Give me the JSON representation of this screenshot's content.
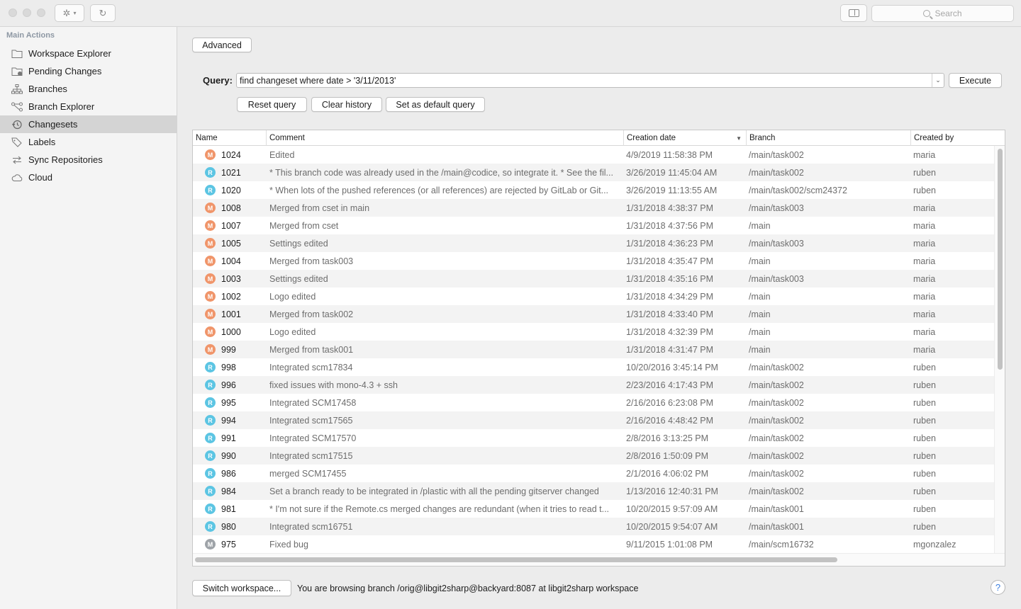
{
  "toolbar": {
    "gear_icon": "gear-icon",
    "refresh_icon": "refresh-icon",
    "panel_icon": "sidebar-toggle-icon",
    "search_placeholder": "Search"
  },
  "sidebar": {
    "header": "Main Actions",
    "items": [
      {
        "label": "Workspace Explorer",
        "icon": "folder-icon"
      },
      {
        "label": "Pending Changes",
        "icon": "pending-folder-icon"
      },
      {
        "label": "Branches",
        "icon": "branches-icon"
      },
      {
        "label": "Branch Explorer",
        "icon": "branch-explorer-icon"
      },
      {
        "label": "Changesets",
        "icon": "history-icon",
        "selected": true
      },
      {
        "label": "Labels",
        "icon": "tag-icon"
      },
      {
        "label": "Sync Repositories",
        "icon": "sync-icon"
      },
      {
        "label": "Cloud",
        "icon": "cloud-icon"
      }
    ]
  },
  "main": {
    "advanced_label": "Advanced",
    "query_label": "Query:",
    "query_value": "find changeset where date > '3/11/2013'",
    "execute_label": "Execute",
    "reset_label": "Reset query",
    "clear_label": "Clear history",
    "default_label": "Set as default query"
  },
  "table": {
    "columns": [
      "Name",
      "Comment",
      "Creation date",
      "Branch",
      "Created by"
    ],
    "sorted_column": "Creation date",
    "rows": [
      {
        "avatar": "M",
        "name": "1024",
        "comment": "Edited",
        "date": "4/9/2019 11:58:38 PM",
        "branch": "/main/task002",
        "by": "maria"
      },
      {
        "avatar": "R",
        "name": "1021",
        "comment": "* This branch code was already used in the /main@codice, so integrate it. * See the fil...",
        "date": "3/26/2019 11:45:04 AM",
        "branch": "/main/task002",
        "by": "ruben"
      },
      {
        "avatar": "R",
        "name": "1020",
        "comment": "* When lots of the pushed references (or all references)  are rejected by GitLab or Git...",
        "date": "3/26/2019 11:13:55 AM",
        "branch": "/main/task002/scm24372",
        "by": "ruben"
      },
      {
        "avatar": "M",
        "name": "1008",
        "comment": "Merged from cset in main",
        "date": "1/31/2018 4:38:37 PM",
        "branch": "/main/task003",
        "by": "maria"
      },
      {
        "avatar": "M",
        "name": "1007",
        "comment": "Merged from cset",
        "date": "1/31/2018 4:37:56 PM",
        "branch": "/main",
        "by": "maria"
      },
      {
        "avatar": "M",
        "name": "1005",
        "comment": "Settings edited",
        "date": "1/31/2018 4:36:23 PM",
        "branch": "/main/task003",
        "by": "maria"
      },
      {
        "avatar": "M",
        "name": "1004",
        "comment": "Merged from task003",
        "date": "1/31/2018 4:35:47 PM",
        "branch": "/main",
        "by": "maria"
      },
      {
        "avatar": "M",
        "name": "1003",
        "comment": "Settings edited",
        "date": "1/31/2018 4:35:16 PM",
        "branch": "/main/task003",
        "by": "maria"
      },
      {
        "avatar": "M",
        "name": "1002",
        "comment": "Logo edited",
        "date": "1/31/2018 4:34:29 PM",
        "branch": "/main",
        "by": "maria"
      },
      {
        "avatar": "M",
        "name": "1001",
        "comment": "Merged from task002",
        "date": "1/31/2018 4:33:40 PM",
        "branch": "/main",
        "by": "maria"
      },
      {
        "avatar": "M",
        "name": "1000",
        "comment": "Logo edited",
        "date": "1/31/2018 4:32:39 PM",
        "branch": "/main",
        "by": "maria"
      },
      {
        "avatar": "M",
        "name": "999",
        "comment": "Merged from task001",
        "date": "1/31/2018 4:31:47 PM",
        "branch": "/main",
        "by": "maria"
      },
      {
        "avatar": "R",
        "name": "998",
        "comment": "Integrated scm17834",
        "date": "10/20/2016 3:45:14 PM",
        "branch": "/main/task002",
        "by": "ruben"
      },
      {
        "avatar": "R",
        "name": "996",
        "comment": "fixed issues with mono-4.3 + ssh",
        "date": "2/23/2016 4:17:43 PM",
        "branch": "/main/task002",
        "by": "ruben"
      },
      {
        "avatar": "R",
        "name": "995",
        "comment": "Integrated SCM17458",
        "date": "2/16/2016 6:23:08 PM",
        "branch": "/main/task002",
        "by": "ruben"
      },
      {
        "avatar": "R",
        "name": "994",
        "comment": "Integrated scm17565",
        "date": "2/16/2016 4:48:42 PM",
        "branch": "/main/task002",
        "by": "ruben"
      },
      {
        "avatar": "R",
        "name": "991",
        "comment": "Integrated SCM17570",
        "date": "2/8/2016 3:13:25 PM",
        "branch": "/main/task002",
        "by": "ruben"
      },
      {
        "avatar": "R",
        "name": "990",
        "comment": "Integrated scm17515",
        "date": "2/8/2016 1:50:09 PM",
        "branch": "/main/task002",
        "by": "ruben"
      },
      {
        "avatar": "R",
        "name": "986",
        "comment": "merged SCM17455",
        "date": "2/1/2016 4:06:02 PM",
        "branch": "/main/task002",
        "by": "ruben"
      },
      {
        "avatar": "R",
        "name": "984",
        "comment": "Set a branch ready to be integrated in /plastic with all the pending gitserver changed",
        "date": "1/13/2016 12:40:31 PM",
        "branch": "/main/task002",
        "by": "ruben"
      },
      {
        "avatar": "R",
        "name": "981",
        "comment": "* I'm not sure if the Remote.cs merged changes are redundant (when it tries to read t...",
        "date": "10/20/2015 9:57:09 AM",
        "branch": "/main/task001",
        "by": "ruben"
      },
      {
        "avatar": "R",
        "name": "980",
        "comment": "Integrated scm16751",
        "date": "10/20/2015 9:54:07 AM",
        "branch": "/main/task001",
        "by": "ruben"
      },
      {
        "avatar": "M",
        "name": "975",
        "comment": "Fixed bug",
        "date": "9/11/2015 1:01:08 PM",
        "branch": "/main/scm16732",
        "by": "mgonzalez"
      }
    ]
  },
  "footer": {
    "switch_label": "Switch workspace...",
    "status": "You are browsing branch /orig@libgit2sharp@backyard:8087 at libgit2sharp workspace",
    "help": "?"
  },
  "colors": {
    "avatar_maria": "#f0956a",
    "avatar_ruben": "#5cc5e3",
    "avatar_mgonzalez": "#9ea3a8",
    "selected_bg": "#d4d4d4"
  }
}
